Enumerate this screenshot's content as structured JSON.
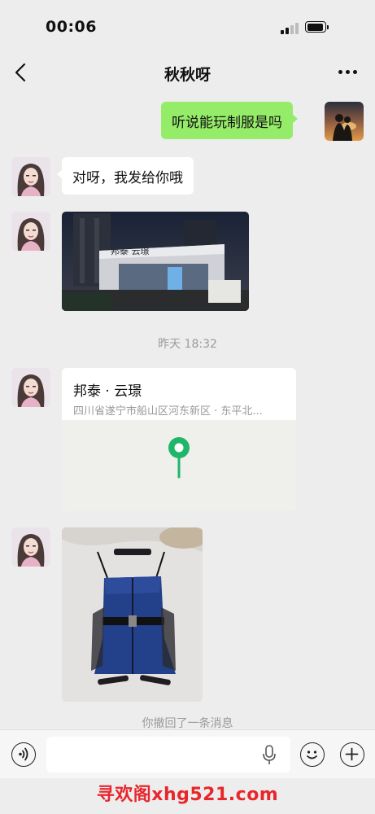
{
  "status_bar": {
    "time": "00:06"
  },
  "nav": {
    "title": "秋秋呀"
  },
  "messages": {
    "outgoing_text": "听说能玩制服是吗",
    "incoming_text": "对呀，我发给你哦",
    "timestamp": "昨天 18:32",
    "location": {
      "name": "邦泰 · 云璟",
      "address": "四川省遂宁市船山区河东新区 · 东平北..."
    },
    "building_sign": "邦泰 云璟",
    "recall_note": "你撤回了一条消息"
  },
  "input": {
    "placeholder": ""
  },
  "watermark": "寻欢阁xhg521.com",
  "colors": {
    "outgoing_bubble": "#95ec69",
    "pin": "#1fb66a",
    "watermark": "#e8262b"
  }
}
